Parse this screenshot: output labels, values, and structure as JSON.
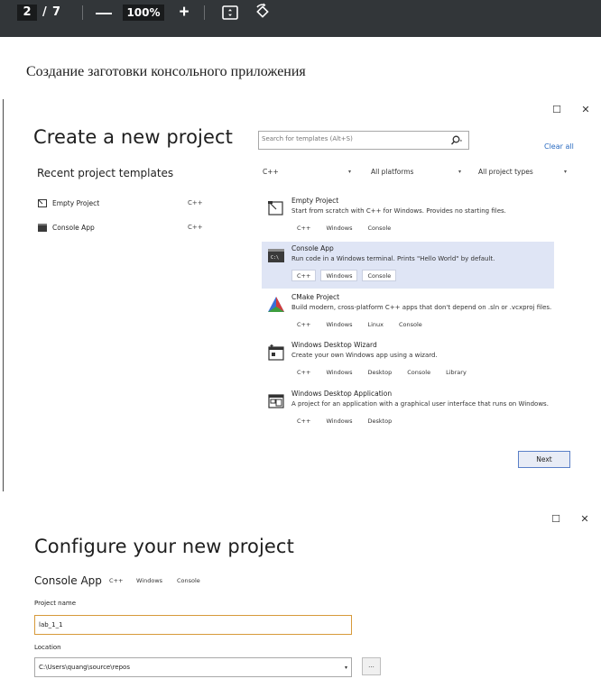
{
  "pdf_toolbar": {
    "current_page": "2",
    "page_separator": "/",
    "total_pages": "7",
    "zoom_out": "—",
    "zoom_level": "100%",
    "zoom_in": "+",
    "icons": [
      "fit-page-icon",
      "rotate-icon"
    ]
  },
  "document": {
    "heading": "Создание заготовки консольного приложения"
  },
  "create_dialog": {
    "window_buttons": {
      "maximize": "☐",
      "close": "✕"
    },
    "title": "Create a new project",
    "recent_title": "Recent project templates",
    "search": {
      "placeholder": "Search for templates (Alt+S)"
    },
    "clear_all": "Clear all",
    "filters": [
      {
        "label": "C++",
        "arrow": "▾"
      },
      {
        "label": "All platforms",
        "arrow": "▾"
      },
      {
        "label": "All project types",
        "arrow": "▾"
      }
    ],
    "recent": [
      {
        "label": "Empty Project",
        "lang": "C++"
      },
      {
        "label": "Console App",
        "lang": "C++"
      }
    ],
    "templates": [
      {
        "name": "Empty Project",
        "description": "Start from scratch with C++ for Windows. Provides no starting files.",
        "tags": [
          "C++",
          "Windows",
          "Console"
        ],
        "selected": false
      },
      {
        "name": "Console App",
        "description": "Run code in a Windows terminal. Prints \"Hello World\" by default.",
        "tags": [
          "C++",
          "Windows",
          "Console"
        ],
        "selected": true
      },
      {
        "name": "CMake Project",
        "description": "Build modern, cross-platform C++ apps that don't depend on .sln or .vcxproj files.",
        "tags": [
          "C++",
          "Windows",
          "Linux",
          "Console"
        ],
        "selected": false
      },
      {
        "name": "Windows Desktop Wizard",
        "description": "Create your own Windows app using a wizard.",
        "tags": [
          "C++",
          "Windows",
          "Desktop",
          "Console",
          "Library"
        ],
        "selected": false
      },
      {
        "name": "Windows Desktop Application",
        "description": "A project for an application with a graphical user interface that runs on Windows.",
        "tags": [
          "C++",
          "Windows",
          "Desktop"
        ],
        "selected": false
      }
    ],
    "next_button": "Next"
  },
  "configure_dialog": {
    "window_buttons": {
      "maximize": "☐",
      "close": "✕"
    },
    "title": "Configure your new project",
    "template_name": "Console App",
    "tags": [
      "C++",
      "Windows",
      "Console"
    ],
    "project_name_label": "Project name",
    "project_name_value": "lab_1_1",
    "location_label": "Location",
    "location_value": "C:\\Users\\quang\\source\\repos",
    "location_arrow": "▾",
    "browse_button": "..."
  }
}
